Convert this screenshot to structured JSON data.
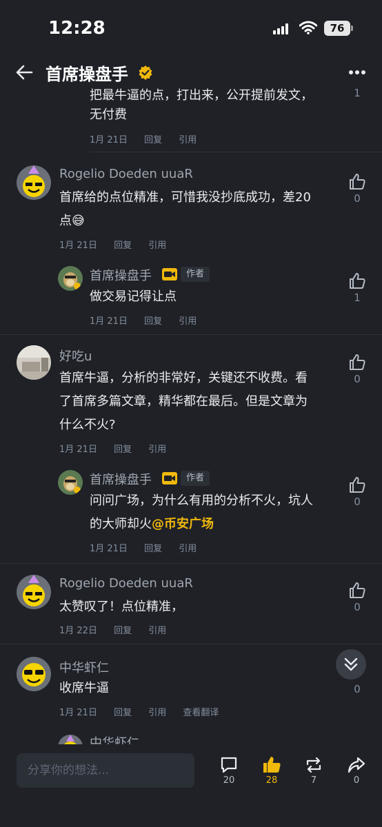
{
  "status": {
    "time": "12:28",
    "battery": "76"
  },
  "header": {
    "title": "首席操盘手"
  },
  "partial_top": {
    "text_line1": "把最牛逼的点，打出来，公开提前发文，",
    "text_line2": "无付费",
    "date": "1月 21日",
    "reply": "回复",
    "quote": "引用",
    "likes": "1"
  },
  "comments": [
    {
      "name": "Rogelio Doeden uuaR",
      "text_line1": "首席给的点位精准，可惜我没抄底成功，差20",
      "text_line2": "点😅",
      "date": "1月 21日",
      "reply": "回复",
      "quote": "引用",
      "likes": "0",
      "reply_item": {
        "name": "首席操盘手",
        "badge": "作者",
        "text": "做交易记得让点",
        "date": "1月 21日",
        "reply": "回复",
        "quote": "引用",
        "likes": "1"
      }
    },
    {
      "name": "好吃u",
      "text_line1": "首席牛逼，分析的非常好，关键还不收费。看",
      "text_line2": "了首席多篇文章，精华都在最后。但是文章为",
      "text_line3": "什么不火?",
      "date": "1月 21日",
      "reply": "回复",
      "quote": "引用",
      "likes": "0",
      "reply_item": {
        "name": "首席操盘手",
        "badge": "作者",
        "text_line1": "问问广场，为什么有用的分析不火，坑人",
        "text_line2": "的大师却火",
        "mention": "@币安广场",
        "date": "1月 21日",
        "reply": "回复",
        "quote": "引用",
        "likes": "0"
      }
    },
    {
      "name": "Rogelio Doeden uuaR",
      "text": "太赞叹了！点位精准，",
      "date": "1月 22日",
      "reply": "回复",
      "quote": "引用",
      "likes": "0"
    },
    {
      "name": "中华虾仁",
      "text": "收席牛逼",
      "date": "1月 21日",
      "reply": "回复",
      "quote": "引用",
      "translate": "查看翻译",
      "likes": "0"
    }
  ],
  "partial_bottom": {
    "name": "中华虾仁"
  },
  "bottom": {
    "placeholder": "分享你的想法...",
    "comments": "20",
    "likes": "28",
    "reposts": "7",
    "shares": "0"
  },
  "colors": {
    "accent": "#f0b90b",
    "bg": "#1f2127"
  },
  "icons": [
    "back-arrow-icon",
    "verified-icon",
    "more-icon",
    "thumb-up-icon",
    "comment-icon",
    "repost-icon",
    "share-icon",
    "chevron-double-down-icon"
  ]
}
